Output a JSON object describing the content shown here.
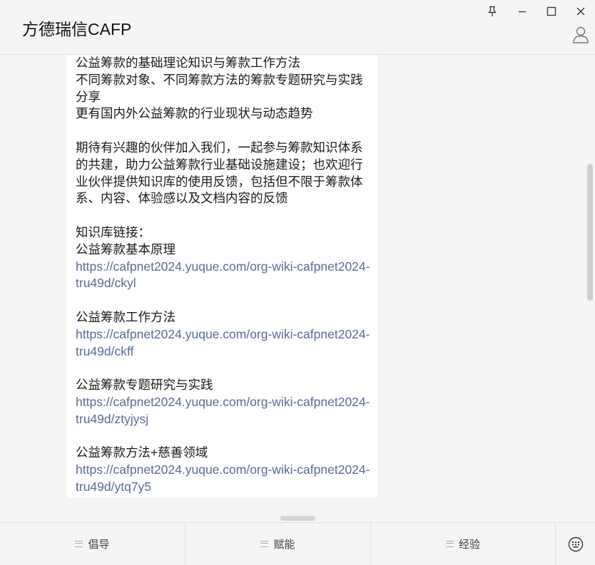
{
  "window": {
    "title": "方德瑞信CAFP",
    "pin_icon": "pin-icon",
    "minimize_icon": "minimize-icon",
    "maximize_icon": "maximize-icon",
    "close_icon": "close-icon",
    "profile_icon": "profile-icon"
  },
  "message": {
    "lines": [
      "公益筹款的基础理论知识与筹款工作方法",
      "不同筹款对象、不同筹款方法的筹款专题研究与实践分享",
      "更有国内外公益筹款的行业现状与动态趋势",
      "期待有兴趣的伙伴加入我们，一起参与筹款知识体系的共建，助力公益筹款行业基础设施建设；也欢迎行业伙伴提供知识库的使用反馈，包括但不限于筹款体系、内容、体验感以及文档内容的反馈",
      "知识库链接："
    ],
    "links": [
      {
        "label": "公益筹款基本原理",
        "url": "https://cafpnet2024.yuque.com/org-wiki-cafpnet2024-tru49d/ckyl"
      },
      {
        "label": "公益筹款工作方法",
        "url": "https://cafpnet2024.yuque.com/org-wiki-cafpnet2024-tru49d/ckff"
      },
      {
        "label": "公益筹款专题研究与实践",
        "url": "https://cafpnet2024.yuque.com/org-wiki-cafpnet2024-tru49d/ztyjysj"
      },
      {
        "label": "公益筹款方法+慈善领域",
        "url": "https://cafpnet2024.yuque.com/org-wiki-cafpnet2024-tru49d/ytq7y5"
      }
    ]
  },
  "footer": {
    "tabs": [
      {
        "label": "倡导"
      },
      {
        "label": "赋能"
      },
      {
        "label": "经验"
      }
    ],
    "keyboard_icon": "keyboard-icon"
  },
  "colors": {
    "link": "#576b95",
    "background": "#f5f5f5",
    "bubble": "#ffffff"
  }
}
